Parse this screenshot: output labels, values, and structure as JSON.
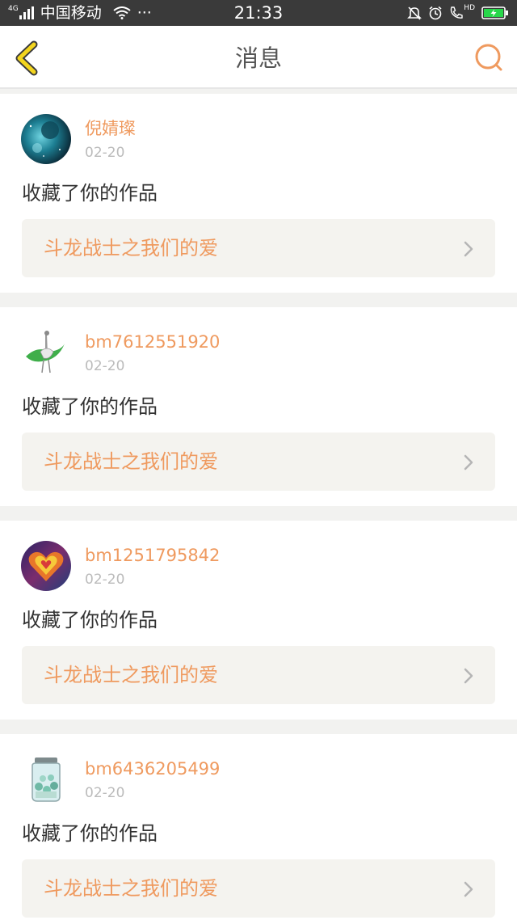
{
  "status_bar": {
    "network": "4G",
    "carrier": "中国移动",
    "more": "···",
    "time": "21:33",
    "hd": "HD"
  },
  "header": {
    "title": "消息",
    "back_icon": "chevron-left-icon",
    "search_icon": "search-icon"
  },
  "colors": {
    "accent": "#ef9a5f",
    "link_bg": "#f4f3ef",
    "status_bar": "#3a3a3a",
    "back_arrow": "#f3d51e"
  },
  "messages": [
    {
      "username": "倪婧璨",
      "date": "02-20",
      "action": "收藏了你的作品",
      "work_title": "斗龙战士之我们的爱"
    },
    {
      "username": "bm7612551920",
      "date": "02-20",
      "action": "收藏了你的作品",
      "work_title": "斗龙战士之我们的爱"
    },
    {
      "username": "bm1251795842",
      "date": "02-20",
      "action": "收藏了你的作品",
      "work_title": "斗龙战士之我们的爱"
    },
    {
      "username": "bm6436205499",
      "date": "02-20",
      "action": "收藏了你的作品",
      "work_title": "斗龙战士之我们的爱"
    }
  ]
}
